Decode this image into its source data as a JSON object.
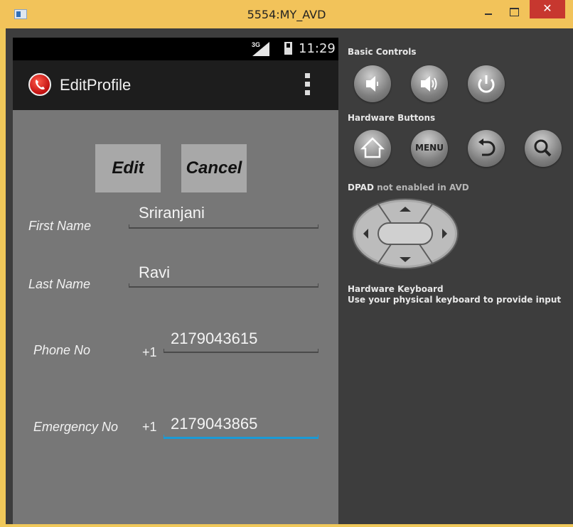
{
  "window": {
    "title": "5554:MY_AVD",
    "close_symbol": "✕"
  },
  "status_bar": {
    "network": "3G",
    "time": "11:29"
  },
  "action_bar": {
    "title": "EditProfile",
    "icon": "phone-app-icon"
  },
  "buttons": {
    "edit": "Edit",
    "cancel": "Cancel"
  },
  "form": {
    "first_name_label": "First Name",
    "first_name_value": "Sriranjani",
    "last_name_label": "Last Name",
    "last_name_value": "Ravi",
    "phone_label": "Phone No",
    "phone_prefix": "+1",
    "phone_value": "2179043615",
    "emergency_label": "Emergency No",
    "emergency_prefix": "+1",
    "emergency_value": "2179043865"
  },
  "controls": {
    "basic_controls": "Basic Controls",
    "hardware_buttons": "Hardware Buttons",
    "menu_label": "MENU",
    "dpad_prefix": "DPAD",
    "dpad_suffix": "not enabled in AVD",
    "keyboard_title": "Hardware Keyboard",
    "keyboard_hint": "Use your physical keyboard to provide input"
  },
  "colors": {
    "title_bar": "#f2c35a",
    "close_button": "#c7372f",
    "phone_background": "#777777",
    "action_bar": "#1d1d1d",
    "focused_underline": "#1a9ad6",
    "panel": "#3d3d3d"
  }
}
